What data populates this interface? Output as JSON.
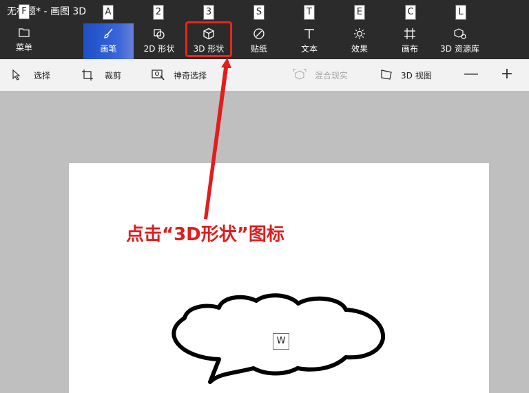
{
  "window": {
    "title": "无标题* - 画图 3D"
  },
  "menu": {
    "label": "菜单",
    "keytip": "F"
  },
  "tabs": [
    {
      "label": "画笔",
      "keytip": "A",
      "icon": "brush-icon"
    },
    {
      "label": "2D 形状",
      "keytip": "2",
      "icon": "2d-shapes-icon"
    },
    {
      "label": "3D 形状",
      "keytip": "3",
      "icon": "3d-cube-icon"
    },
    {
      "label": "贴纸",
      "keytip": "S",
      "icon": "sticker-icon"
    },
    {
      "label": "文本",
      "keytip": "T",
      "icon": "text-icon"
    },
    {
      "label": "效果",
      "keytip": "E",
      "icon": "sun-effects-icon"
    },
    {
      "label": "画布",
      "keytip": "C",
      "icon": "canvas-icon"
    },
    {
      "label": "3D 资源库",
      "keytip": "L",
      "icon": "3d-library-icon"
    }
  ],
  "active_tab": "画笔",
  "toolbar": {
    "select": "选择",
    "crop": "裁剪",
    "magic_select": "神奇选择",
    "mixed_reality": "混合现实",
    "view_3d": "3D 视图",
    "zoom_out": "—",
    "zoom_in": "+"
  },
  "canvas": {
    "annotation": "点击“3D形状”图标",
    "keytip": "W"
  },
  "colors": {
    "ribbon_bg": "#2b2b2b",
    "active_tab": "#2f5fd4",
    "highlight_red": "#e8261d",
    "toolbar_bg": "#f2f2f2",
    "workspace_bg": "#bfbfbf",
    "canvas_bg": "#ffffff"
  }
}
